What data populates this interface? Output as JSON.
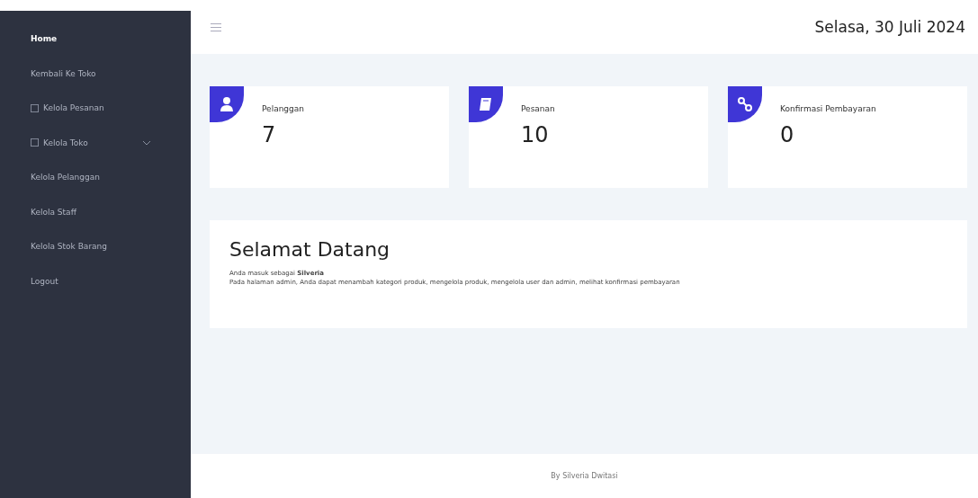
{
  "sidebar": {
    "items": [
      {
        "label": "Home",
        "selected": true,
        "icon": false,
        "expandable": false
      },
      {
        "label": "Kembali Ke Toko",
        "selected": false,
        "icon": false,
        "expandable": false
      },
      {
        "label": "Kelola Pesanan",
        "selected": false,
        "icon": true,
        "expandable": false
      },
      {
        "label": "Kelola Toko",
        "selected": false,
        "icon": true,
        "expandable": true
      },
      {
        "label": "Kelola Pelanggan",
        "selected": false,
        "icon": false,
        "expandable": false
      },
      {
        "label": "Kelola Staff",
        "selected": false,
        "icon": false,
        "expandable": false
      },
      {
        "label": "Kelola Stok Barang",
        "selected": false,
        "icon": false,
        "expandable": false
      },
      {
        "label": "Logout",
        "selected": false,
        "icon": false,
        "expandable": false
      }
    ]
  },
  "header": {
    "date": "Selasa, 30 Juli 2024"
  },
  "stats": [
    {
      "kind": "user",
      "label": "Pelanggan",
      "value": "7"
    },
    {
      "kind": "book",
      "label": "Pesanan",
      "value": "10"
    },
    {
      "kind": "link",
      "label": "Konfirmasi Pembayaran",
      "value": "0"
    }
  ],
  "welcome": {
    "title": "Selamat Datang",
    "intro": "Anda masuk sebagai **Silveria**",
    "text": "Pada halaman admin, Anda dapat menambah kategori produk, mengelola produk, mengelola user dan admin, melihat konfirmasi pembayaran"
  },
  "footer": {
    "text": "By Silveria Dwitasi"
  }
}
